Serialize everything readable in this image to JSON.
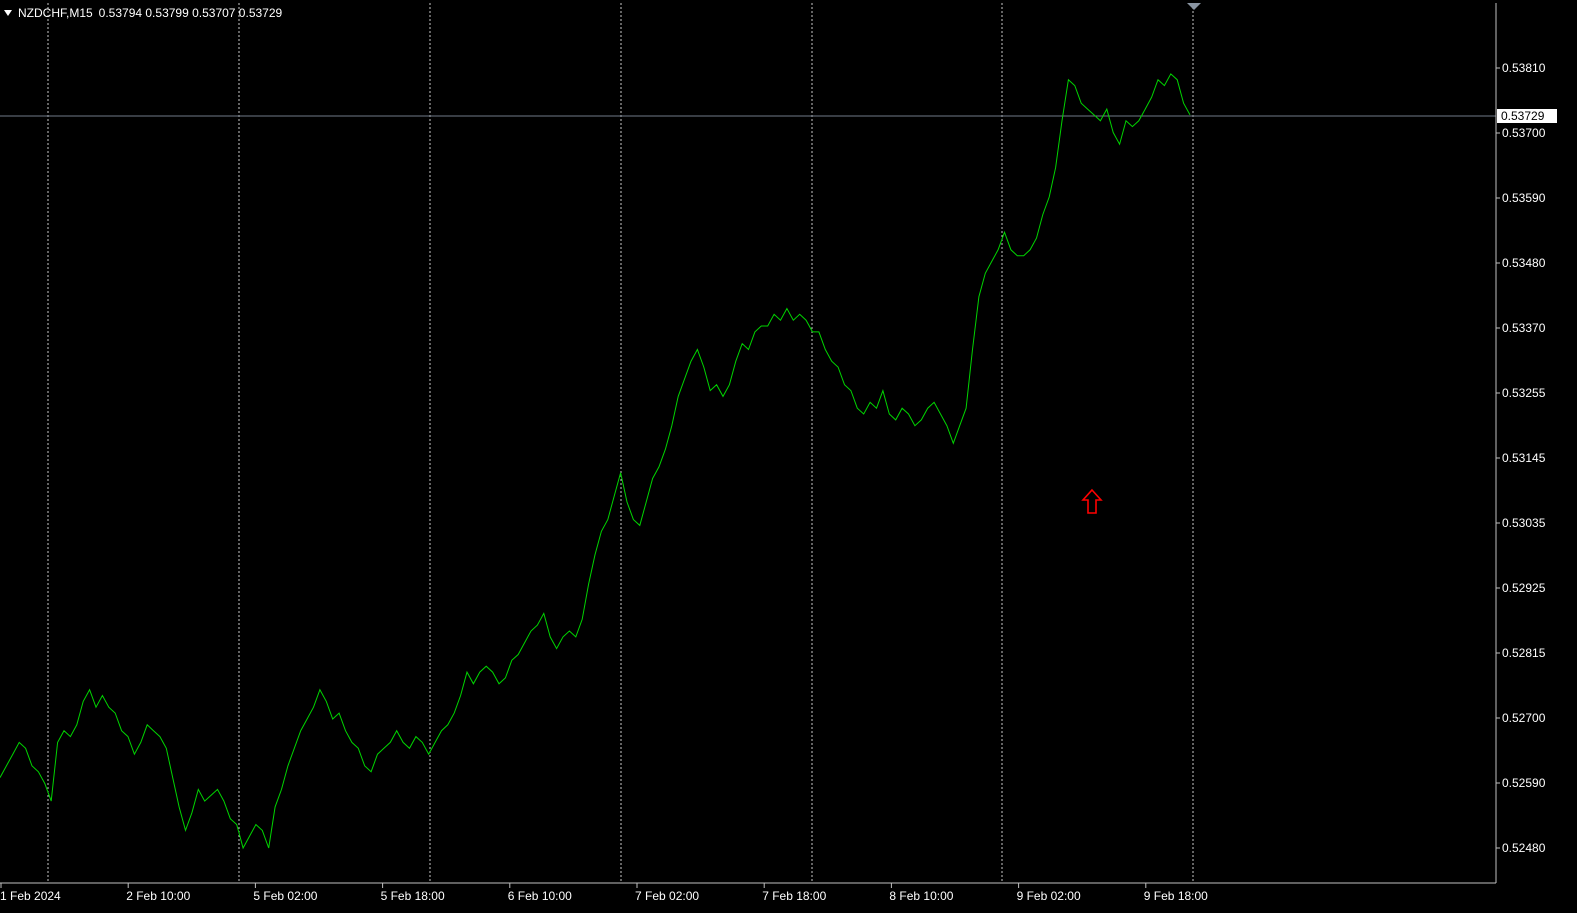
{
  "header": {
    "symbol": "NZDCHF,M15",
    "ohlc": "0.53794 0.53799 0.53707 0.53729"
  },
  "colors": {
    "background": "#000000",
    "line": "#00d400",
    "grid": "#c8c8c8",
    "axis": "#c0c0c0",
    "current_price_line": "#6f7a87",
    "marker": "#ff0000"
  },
  "marker": {
    "icon": "red-up-arrow-icon"
  },
  "chart_data": {
    "type": "line",
    "symbol": "NZDCHF",
    "timeframe": "M15",
    "current_price": "0.53729",
    "y_ticks": [
      "0.53810",
      "0.53700",
      "0.53590",
      "0.53480",
      "0.53370",
      "0.53255",
      "0.53145",
      "0.53035",
      "0.52925",
      "0.52815",
      "0.52700",
      "0.52590",
      "0.52480"
    ],
    "x_ticks": [
      "1 Feb 2024",
      "2 Feb 10:00",
      "5 Feb 02:00",
      "5 Feb 18:00",
      "6 Feb 10:00",
      "7 Feb 02:00",
      "7 Feb 18:00",
      "8 Feb 10:00",
      "9 Feb 02:00",
      "9 Feb 18:00"
    ],
    "ylim": [
      0.52425,
      0.53905
    ],
    "series": [
      {
        "values": [
          0.526,
          0.5262,
          0.5264,
          0.5266,
          0.5265,
          0.5262,
          0.5261,
          0.5259,
          0.5256,
          0.5266,
          0.5268,
          0.5267,
          0.5269,
          0.5273,
          0.5275,
          0.5272,
          0.5274,
          0.5272,
          0.5271,
          0.5268,
          0.5267,
          0.5264,
          0.5266,
          0.5269,
          0.5268,
          0.5267,
          0.5265,
          0.526,
          0.5255,
          0.5251,
          0.5254,
          0.5258,
          0.5256,
          0.5257,
          0.5258,
          0.5256,
          0.5253,
          0.5252,
          0.5248,
          0.525,
          0.5252,
          0.5251,
          0.5248,
          0.5255,
          0.5258,
          0.5262,
          0.5265,
          0.5268,
          0.527,
          0.5272,
          0.5275,
          0.5273,
          0.527,
          0.5271,
          0.5268,
          0.5266,
          0.5265,
          0.5262,
          0.5261,
          0.5264,
          0.5265,
          0.5266,
          0.5268,
          0.5266,
          0.5265,
          0.5267,
          0.5266,
          0.5264,
          0.5266,
          0.5268,
          0.5269,
          0.5271,
          0.5274,
          0.5278,
          0.5276,
          0.5278,
          0.5279,
          0.5278,
          0.5276,
          0.5277,
          0.528,
          0.5281,
          0.5283,
          0.5285,
          0.5286,
          0.5288,
          0.5284,
          0.5282,
          0.5284,
          0.5285,
          0.5284,
          0.5287,
          0.5293,
          0.5298,
          0.5302,
          0.5304,
          0.5308,
          0.5312,
          0.5307,
          0.5304,
          0.5303,
          0.5307,
          0.5311,
          0.5313,
          0.5316,
          0.532,
          0.5325,
          0.5328,
          0.5331,
          0.5333,
          0.533,
          0.5326,
          0.5327,
          0.5325,
          0.5327,
          0.5331,
          0.5334,
          0.5333,
          0.5336,
          0.5337,
          0.5337,
          0.5339,
          0.5338,
          0.534,
          0.5338,
          0.5339,
          0.5338,
          0.5336,
          0.5336,
          0.5333,
          0.5331,
          0.533,
          0.5327,
          0.5326,
          0.5323,
          0.5322,
          0.5324,
          0.5323,
          0.5326,
          0.5322,
          0.5321,
          0.5323,
          0.5322,
          0.532,
          0.5321,
          0.5323,
          0.5324,
          0.5322,
          0.532,
          0.5317,
          0.532,
          0.5323,
          0.5333,
          0.5342,
          0.5346,
          0.5348,
          0.535,
          0.5353,
          0.535,
          0.5349,
          0.5349,
          0.535,
          0.5352,
          0.5356,
          0.5359,
          0.5364,
          0.5372,
          0.5379,
          0.5378,
          0.5375,
          0.5374,
          0.5373,
          0.5372,
          0.5374,
          0.537,
          0.5368,
          0.5372,
          0.5371,
          0.5372,
          0.5374,
          0.5376,
          0.5379,
          0.5378,
          0.538,
          0.5379,
          0.5375,
          0.5373
        ]
      }
    ]
  }
}
